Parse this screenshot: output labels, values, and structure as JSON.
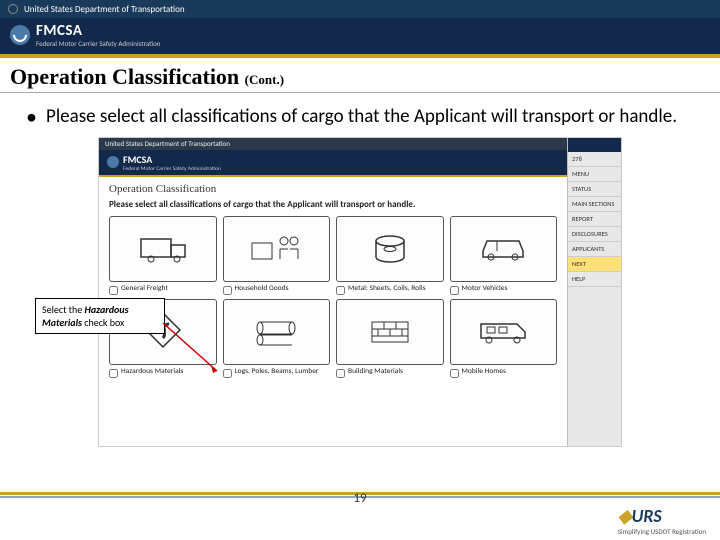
{
  "topbar": {
    "dept": "United States Department of Transportation"
  },
  "fmcsa": {
    "title": "FMCSA",
    "sub": "Federal Motor Carrier Safety Administration"
  },
  "slide": {
    "title": "Operation Classification",
    "cont": "(Cont.)",
    "bullet": "Please select all classifications of cargo that the Applicant will transport or handle."
  },
  "screenshot": {
    "topbar": "United States Department of Transportation",
    "hdr": "FMCSA",
    "sub": "Federal Motor Carrier Safety Administration",
    "h2": "Operation Classification",
    "instr": "Please select all classifications of cargo that the Applicant will transport or handle.",
    "cargo": [
      {
        "label": "General Freight",
        "icon": "truck"
      },
      {
        "label": "Household Goods",
        "icon": "house"
      },
      {
        "label": "Metal: Sheets, Coils, Rolls",
        "icon": "coil"
      },
      {
        "label": "Motor Vehicles",
        "icon": "car"
      },
      {
        "label": "Hazardous Materials",
        "icon": "hazmat"
      },
      {
        "label": "Logs, Poles, Beams, Lumber",
        "icon": "logs"
      },
      {
        "label": "Building Materials",
        "icon": "bricks"
      },
      {
        "label": "Mobile Homes",
        "icon": "rv"
      }
    ],
    "side": {
      "top_items": [
        "278",
        "MENU",
        "STATUS",
        "MAIN SECTIONS",
        "REPORT",
        "DISCLOSURES",
        "APPLICANTS"
      ],
      "active": "NEXT",
      "bottom_items": [
        "HELP"
      ]
    }
  },
  "callout": {
    "pre": "Select the ",
    "em": "Hazardous Materials",
    "post": " check box"
  },
  "footer": {
    "page": "19",
    "urs": "URS",
    "urs_sub": "Simplifying USDOT Registration"
  }
}
